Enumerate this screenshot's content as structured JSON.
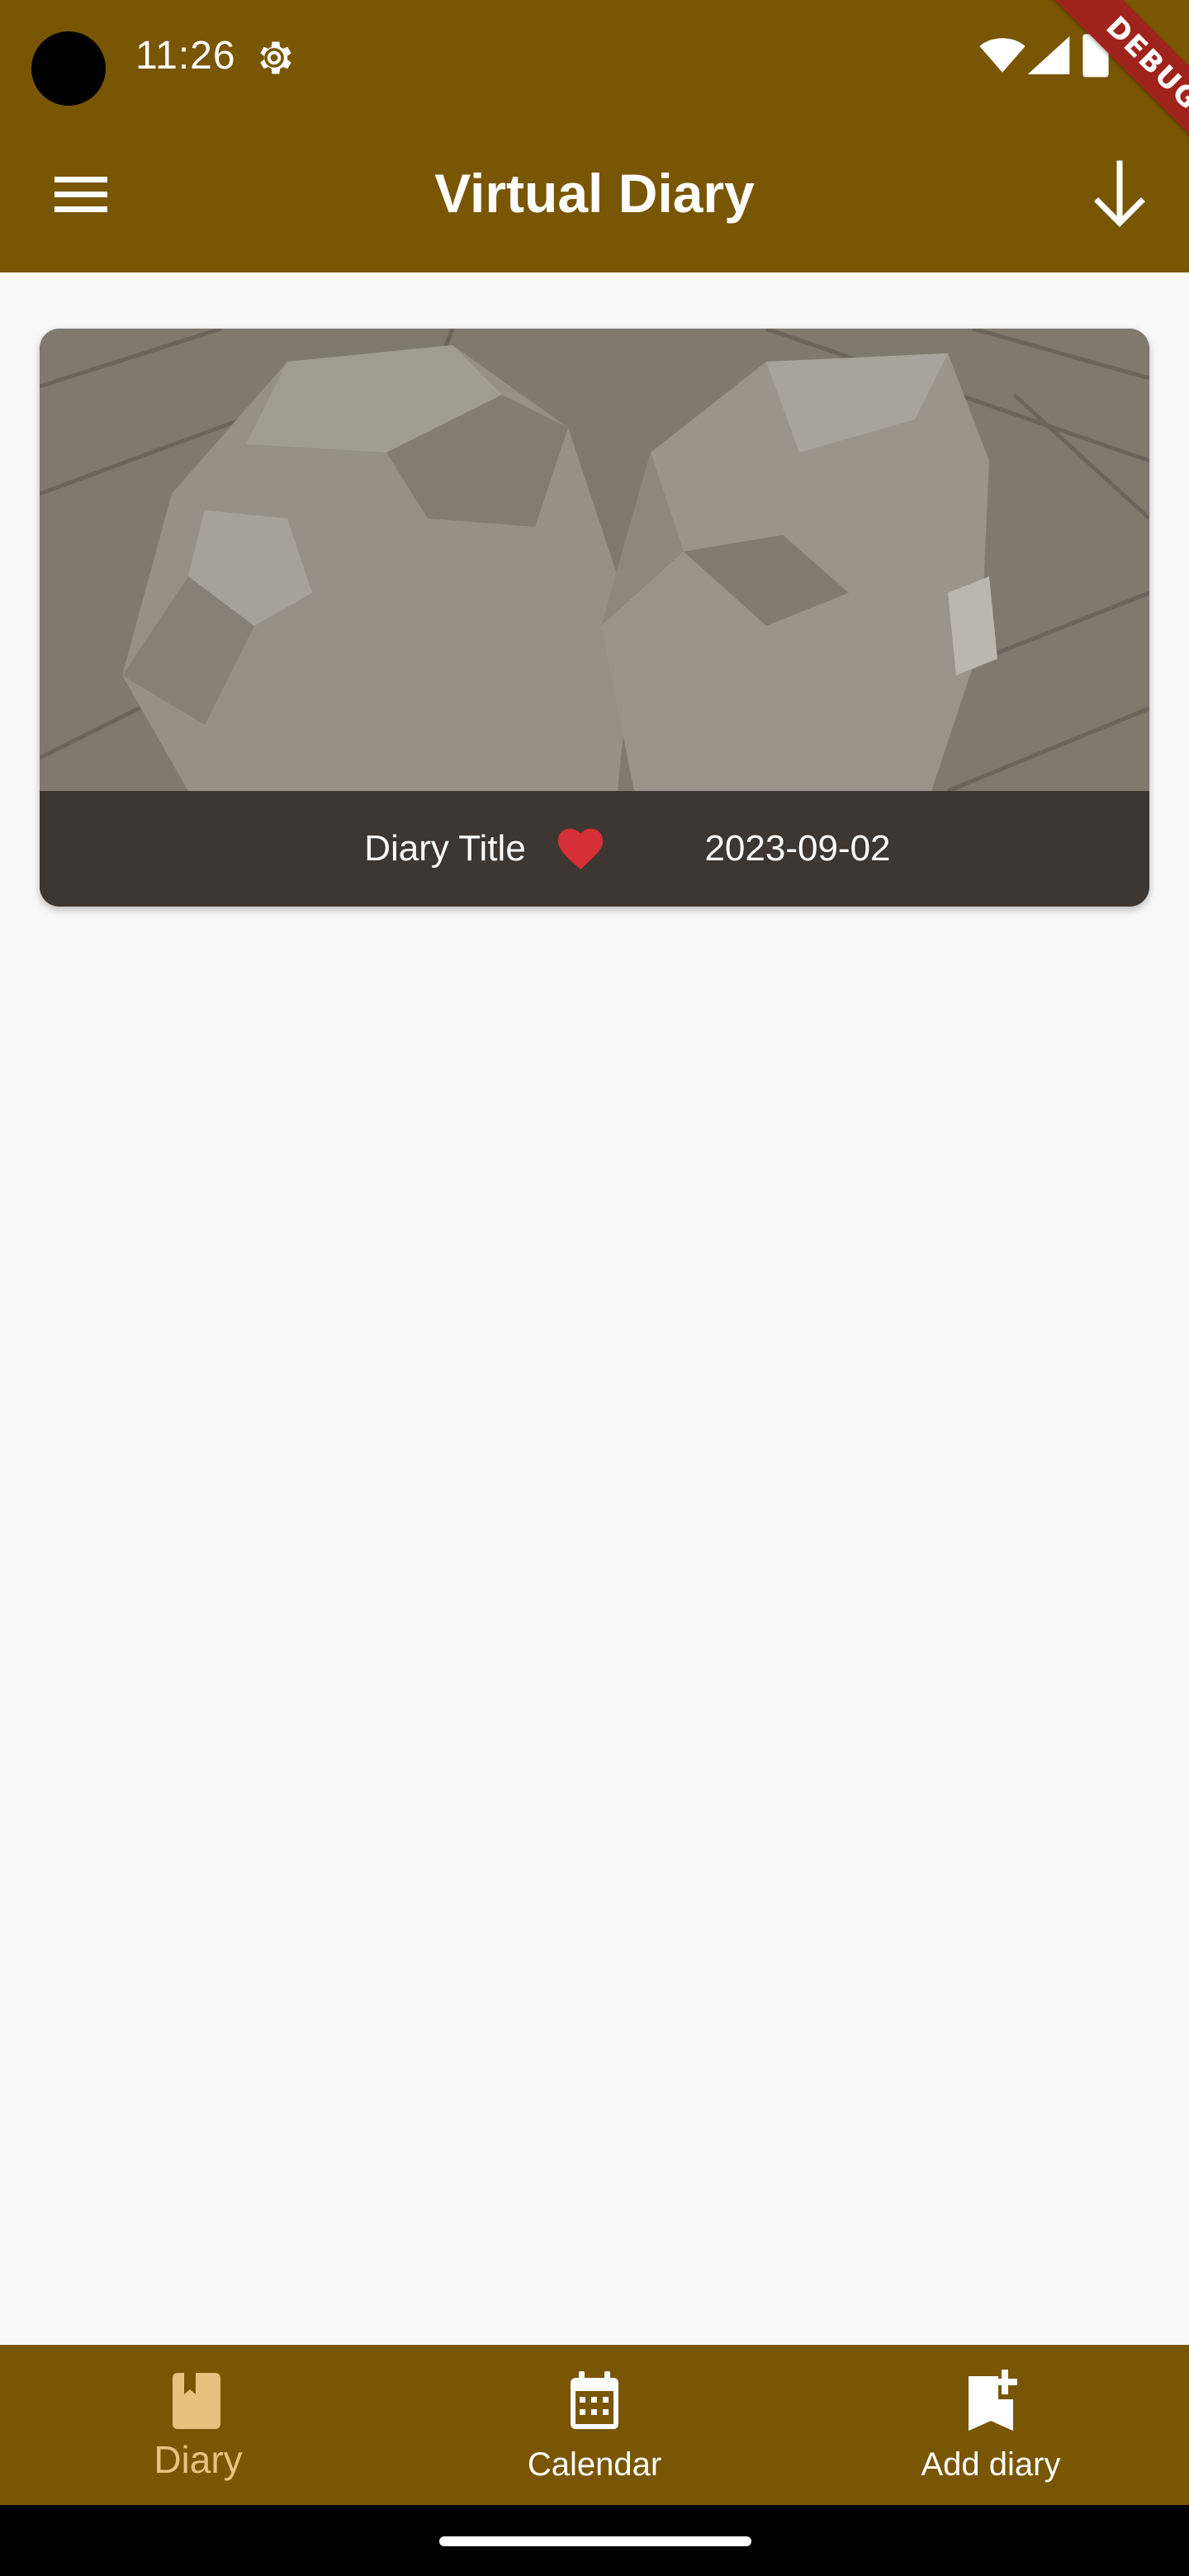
{
  "status_bar": {
    "time": "11:26",
    "icons": [
      "settings-gear-icon",
      "wifi-icon",
      "cellular-signal-icon",
      "battery-icon"
    ]
  },
  "debug_banner": "DEBUG",
  "app_bar": {
    "title": "Virtual Diary",
    "menu_icon": "hamburger-menu-icon",
    "action_icon": "arrow-down-icon"
  },
  "diary_entries": [
    {
      "title": "Diary Title",
      "mood_icon": "heart-icon",
      "date": "2023-09-02"
    }
  ],
  "bottom_nav": {
    "items": [
      {
        "label": "Diary",
        "icon": "diary-book-icon",
        "active": true
      },
      {
        "label": "Calendar",
        "icon": "calendar-icon",
        "active": false
      },
      {
        "label": "Add diary",
        "icon": "add-bookmark-icon",
        "active": false
      }
    ]
  },
  "colors": {
    "app_bar": "#795603",
    "background": "#f9f9f9",
    "active_nav": "#e7c27f",
    "inactive_nav": "#ffffff",
    "debug_ribbon": "#a0231b",
    "heart": "#d62f35"
  }
}
